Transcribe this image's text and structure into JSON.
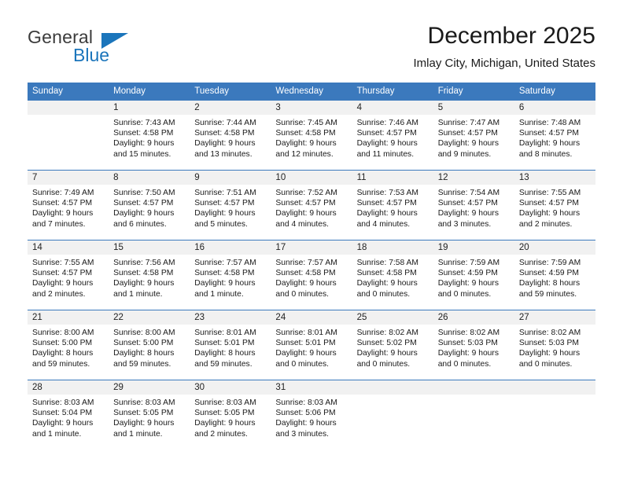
{
  "brand": {
    "name_top": "General",
    "name_bottom": "Blue",
    "accent_color": "#1b75bb"
  },
  "header": {
    "title": "December 2025",
    "location": "Imlay City, Michigan, United States"
  },
  "theme": {
    "header_row_bg": "#3b79bd",
    "daynum_bg": "#f1f1f1",
    "text_color": "#1a1a1a"
  },
  "weekday_headers": [
    "Sunday",
    "Monday",
    "Tuesday",
    "Wednesday",
    "Thursday",
    "Friday",
    "Saturday"
  ],
  "weeks": [
    [
      {
        "day": "",
        "sunrise": "",
        "sunset": "",
        "daylight_1": "",
        "daylight_2": "",
        "empty": true
      },
      {
        "day": "1",
        "sunrise": "Sunrise: 7:43 AM",
        "sunset": "Sunset: 4:58 PM",
        "daylight_1": "Daylight: 9 hours",
        "daylight_2": "and 15 minutes."
      },
      {
        "day": "2",
        "sunrise": "Sunrise: 7:44 AM",
        "sunset": "Sunset: 4:58 PM",
        "daylight_1": "Daylight: 9 hours",
        "daylight_2": "and 13 minutes."
      },
      {
        "day": "3",
        "sunrise": "Sunrise: 7:45 AM",
        "sunset": "Sunset: 4:58 PM",
        "daylight_1": "Daylight: 9 hours",
        "daylight_2": "and 12 minutes."
      },
      {
        "day": "4",
        "sunrise": "Sunrise: 7:46 AM",
        "sunset": "Sunset: 4:57 PM",
        "daylight_1": "Daylight: 9 hours",
        "daylight_2": "and 11 minutes."
      },
      {
        "day": "5",
        "sunrise": "Sunrise: 7:47 AM",
        "sunset": "Sunset: 4:57 PM",
        "daylight_1": "Daylight: 9 hours",
        "daylight_2": "and 9 minutes."
      },
      {
        "day": "6",
        "sunrise": "Sunrise: 7:48 AM",
        "sunset": "Sunset: 4:57 PM",
        "daylight_1": "Daylight: 9 hours",
        "daylight_2": "and 8 minutes."
      }
    ],
    [
      {
        "day": "7",
        "sunrise": "Sunrise: 7:49 AM",
        "sunset": "Sunset: 4:57 PM",
        "daylight_1": "Daylight: 9 hours",
        "daylight_2": "and 7 minutes."
      },
      {
        "day": "8",
        "sunrise": "Sunrise: 7:50 AM",
        "sunset": "Sunset: 4:57 PM",
        "daylight_1": "Daylight: 9 hours",
        "daylight_2": "and 6 minutes."
      },
      {
        "day": "9",
        "sunrise": "Sunrise: 7:51 AM",
        "sunset": "Sunset: 4:57 PM",
        "daylight_1": "Daylight: 9 hours",
        "daylight_2": "and 5 minutes."
      },
      {
        "day": "10",
        "sunrise": "Sunrise: 7:52 AM",
        "sunset": "Sunset: 4:57 PM",
        "daylight_1": "Daylight: 9 hours",
        "daylight_2": "and 4 minutes."
      },
      {
        "day": "11",
        "sunrise": "Sunrise: 7:53 AM",
        "sunset": "Sunset: 4:57 PM",
        "daylight_1": "Daylight: 9 hours",
        "daylight_2": "and 4 minutes."
      },
      {
        "day": "12",
        "sunrise": "Sunrise: 7:54 AM",
        "sunset": "Sunset: 4:57 PM",
        "daylight_1": "Daylight: 9 hours",
        "daylight_2": "and 3 minutes."
      },
      {
        "day": "13",
        "sunrise": "Sunrise: 7:55 AM",
        "sunset": "Sunset: 4:57 PM",
        "daylight_1": "Daylight: 9 hours",
        "daylight_2": "and 2 minutes."
      }
    ],
    [
      {
        "day": "14",
        "sunrise": "Sunrise: 7:55 AM",
        "sunset": "Sunset: 4:57 PM",
        "daylight_1": "Daylight: 9 hours",
        "daylight_2": "and 2 minutes."
      },
      {
        "day": "15",
        "sunrise": "Sunrise: 7:56 AM",
        "sunset": "Sunset: 4:58 PM",
        "daylight_1": "Daylight: 9 hours",
        "daylight_2": "and 1 minute."
      },
      {
        "day": "16",
        "sunrise": "Sunrise: 7:57 AM",
        "sunset": "Sunset: 4:58 PM",
        "daylight_1": "Daylight: 9 hours",
        "daylight_2": "and 1 minute."
      },
      {
        "day": "17",
        "sunrise": "Sunrise: 7:57 AM",
        "sunset": "Sunset: 4:58 PM",
        "daylight_1": "Daylight: 9 hours",
        "daylight_2": "and 0 minutes."
      },
      {
        "day": "18",
        "sunrise": "Sunrise: 7:58 AM",
        "sunset": "Sunset: 4:58 PM",
        "daylight_1": "Daylight: 9 hours",
        "daylight_2": "and 0 minutes."
      },
      {
        "day": "19",
        "sunrise": "Sunrise: 7:59 AM",
        "sunset": "Sunset: 4:59 PM",
        "daylight_1": "Daylight: 9 hours",
        "daylight_2": "and 0 minutes."
      },
      {
        "day": "20",
        "sunrise": "Sunrise: 7:59 AM",
        "sunset": "Sunset: 4:59 PM",
        "daylight_1": "Daylight: 8 hours",
        "daylight_2": "and 59 minutes."
      }
    ],
    [
      {
        "day": "21",
        "sunrise": "Sunrise: 8:00 AM",
        "sunset": "Sunset: 5:00 PM",
        "daylight_1": "Daylight: 8 hours",
        "daylight_2": "and 59 minutes."
      },
      {
        "day": "22",
        "sunrise": "Sunrise: 8:00 AM",
        "sunset": "Sunset: 5:00 PM",
        "daylight_1": "Daylight: 8 hours",
        "daylight_2": "and 59 minutes."
      },
      {
        "day": "23",
        "sunrise": "Sunrise: 8:01 AM",
        "sunset": "Sunset: 5:01 PM",
        "daylight_1": "Daylight: 8 hours",
        "daylight_2": "and 59 minutes."
      },
      {
        "day": "24",
        "sunrise": "Sunrise: 8:01 AM",
        "sunset": "Sunset: 5:01 PM",
        "daylight_1": "Daylight: 9 hours",
        "daylight_2": "and 0 minutes."
      },
      {
        "day": "25",
        "sunrise": "Sunrise: 8:02 AM",
        "sunset": "Sunset: 5:02 PM",
        "daylight_1": "Daylight: 9 hours",
        "daylight_2": "and 0 minutes."
      },
      {
        "day": "26",
        "sunrise": "Sunrise: 8:02 AM",
        "sunset": "Sunset: 5:03 PM",
        "daylight_1": "Daylight: 9 hours",
        "daylight_2": "and 0 minutes."
      },
      {
        "day": "27",
        "sunrise": "Sunrise: 8:02 AM",
        "sunset": "Sunset: 5:03 PM",
        "daylight_1": "Daylight: 9 hours",
        "daylight_2": "and 0 minutes."
      }
    ],
    [
      {
        "day": "28",
        "sunrise": "Sunrise: 8:03 AM",
        "sunset": "Sunset: 5:04 PM",
        "daylight_1": "Daylight: 9 hours",
        "daylight_2": "and 1 minute."
      },
      {
        "day": "29",
        "sunrise": "Sunrise: 8:03 AM",
        "sunset": "Sunset: 5:05 PM",
        "daylight_1": "Daylight: 9 hours",
        "daylight_2": "and 1 minute."
      },
      {
        "day": "30",
        "sunrise": "Sunrise: 8:03 AM",
        "sunset": "Sunset: 5:05 PM",
        "daylight_1": "Daylight: 9 hours",
        "daylight_2": "and 2 minutes."
      },
      {
        "day": "31",
        "sunrise": "Sunrise: 8:03 AM",
        "sunset": "Sunset: 5:06 PM",
        "daylight_1": "Daylight: 9 hours",
        "daylight_2": "and 3 minutes."
      },
      {
        "day": "",
        "sunrise": "",
        "sunset": "",
        "daylight_1": "",
        "daylight_2": "",
        "empty": true
      },
      {
        "day": "",
        "sunrise": "",
        "sunset": "",
        "daylight_1": "",
        "daylight_2": "",
        "empty": true
      },
      {
        "day": "",
        "sunrise": "",
        "sunset": "",
        "daylight_1": "",
        "daylight_2": "",
        "empty": true
      }
    ]
  ]
}
